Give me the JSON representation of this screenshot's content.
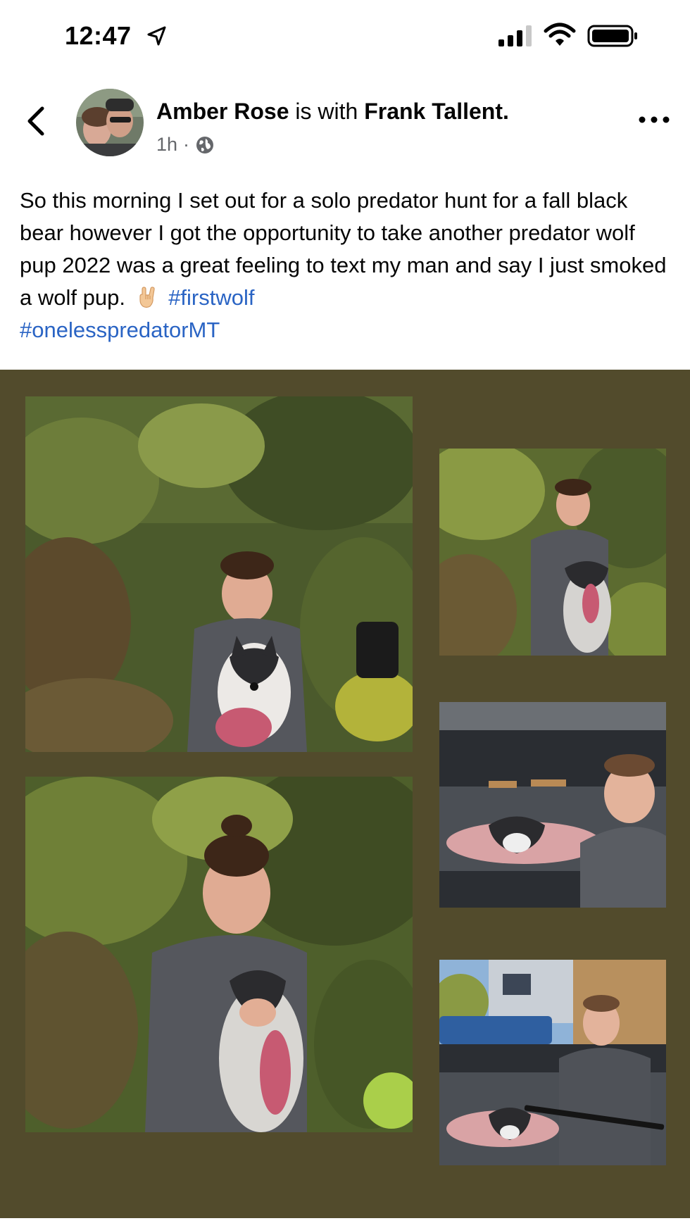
{
  "status_bar": {
    "time": "12:47",
    "icons": [
      "location-arrow-icon",
      "cellular-signal-icon",
      "wifi-icon",
      "battery-icon"
    ]
  },
  "post": {
    "author": "Amber Rose",
    "with_text": " is with ",
    "tagged": "Frank Tallent.",
    "time_ago": "1h",
    "separator": "·",
    "privacy_icon": "globe-icon",
    "text_main": "So this morning I set out for a solo predator hunt for a fall black bear however I got the opportunity to take another predator wolf pup 2022 was a great feeling to text my man and say I just smoked a wolf pup.",
    "emoji": "🤘",
    "hashtags": [
      "#firstwolf",
      "#onelesspredatorMT"
    ]
  },
  "colors": {
    "hashtag": "#2a64c4",
    "collage_background": "#524b2c",
    "meta_text": "#65676b"
  },
  "collage": {
    "photos": [
      {
        "id": "photo-1",
        "description_icon": "photo"
      },
      {
        "id": "photo-2",
        "description_icon": "photo"
      },
      {
        "id": "photo-3",
        "description_icon": "photo"
      },
      {
        "id": "photo-4",
        "description_icon": "photo"
      },
      {
        "id": "photo-5",
        "description_icon": "photo"
      }
    ]
  }
}
